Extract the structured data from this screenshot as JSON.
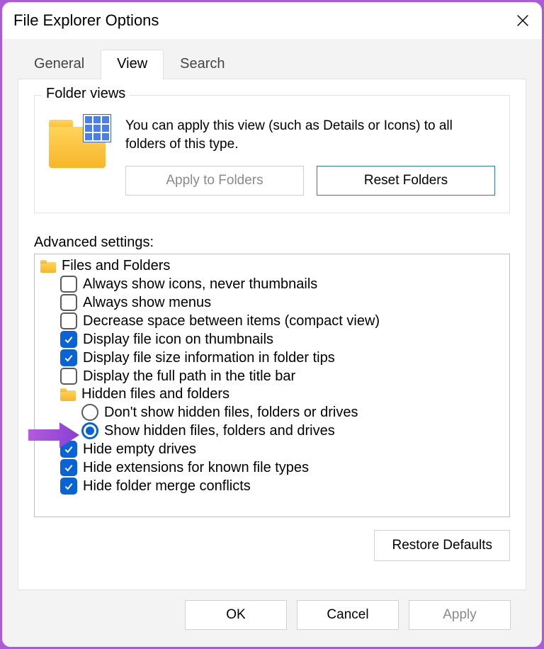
{
  "window": {
    "title": "File Explorer Options"
  },
  "tabs": {
    "general": "General",
    "view": "View",
    "search": "Search",
    "active": "view"
  },
  "folder_views": {
    "legend": "Folder views",
    "description": "You can apply this view (such as Details or Icons) to all folders of this type.",
    "apply_label": "Apply to Folders",
    "reset_label": "Reset Folders"
  },
  "advanced": {
    "label": "Advanced settings:",
    "root_label": "Files and Folders",
    "items": {
      "always_icons": "Always show icons, never thumbnails",
      "always_menus": "Always show menus",
      "compact": "Decrease space between items (compact view)",
      "file_icon_thumb": "Display file icon on thumbnails",
      "size_tips": "Display file size information in folder tips",
      "full_path": "Display the full path in the title bar",
      "hidden_group": "Hidden files and folders",
      "hidden_dont_show": "Don't show hidden files, folders or drives",
      "hidden_show": "Show hidden files, folders and drives",
      "hide_empty": "Hide empty drives",
      "hide_ext": "Hide extensions for known file types",
      "hide_merge": "Hide folder merge conflicts"
    },
    "state": {
      "always_icons": false,
      "always_menus": false,
      "compact": false,
      "file_icon_thumb": true,
      "size_tips": true,
      "full_path": false,
      "hidden_radio": "show",
      "hide_empty": true,
      "hide_ext": true,
      "hide_merge": true
    }
  },
  "buttons": {
    "restore": "Restore Defaults",
    "ok": "OK",
    "cancel": "Cancel",
    "apply": "Apply"
  },
  "annotation": {
    "arrow_target": "hidden_show"
  }
}
